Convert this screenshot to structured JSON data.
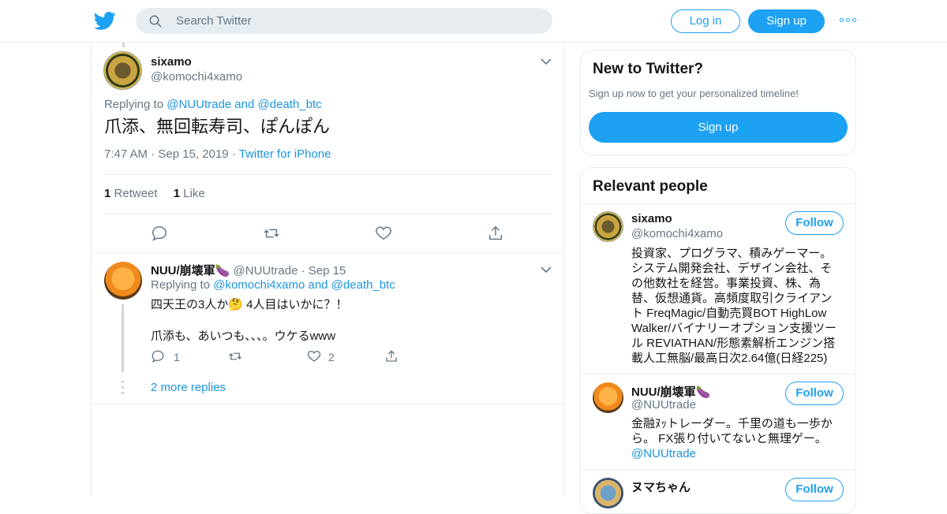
{
  "header": {
    "search_placeholder": "Search Twitter",
    "login_label": "Log in",
    "signup_label": "Sign up"
  },
  "main_tweet": {
    "name": "sixamo",
    "handle": "@komochi4xamo",
    "replying_prefix": "Replying to",
    "replying_to": "@NUUtrade and @death_btc",
    "text": "爪添、無回転寿司、ぽんぽん",
    "time": "7:47 AM",
    "date": "Sep 15, 2019",
    "source": "Twitter for iPhone",
    "retweets_count": "1",
    "retweets_label": "Retweet",
    "likes_count": "1",
    "likes_label": "Like"
  },
  "reply": {
    "name": "NUU/崩壊軍🍆",
    "handle": "@NUUtrade",
    "date": "Sep 15",
    "replying_prefix": "Replying to",
    "replying_to": "@komochi4xamo and @death_btc",
    "line1": "四天王の3人か🤔 4人目はいかに？！",
    "line2": "爪添も、あいつも、、、。ウケるwww",
    "reply_count": "1",
    "like_count": "2",
    "more_replies": "2 more replies"
  },
  "new_card": {
    "title": "New to Twitter?",
    "subtitle": "Sign up now to get your personalized timeline!",
    "button": "Sign up"
  },
  "relevant": {
    "title": "Relevant people",
    "follow_label": "Follow",
    "people": [
      {
        "name": "sixamo",
        "handle": "@komochi4xamo",
        "bio_lines": [
          "投資家、プログラマ、積みゲーマー。",
          "システム開発会社、デザイン会社、そ",
          "の他数社を経営。事業投資、株、為",
          "替、仮想通貨。高頻度取引クライアン",
          "ト FreqMagic/自動売買BOT HighLow",
          "Walker/バイナリーオプション支援ツー",
          "ル REVIATHAN/形態素解析エンジン搭",
          "載人工無脳/最高日次2.64億(日経225)"
        ]
      },
      {
        "name": "NUU/崩壊軍🍆",
        "handle": "@NUUtrade",
        "bio_lines": [
          "金融ﾇｯトレーダー。千里の道も一歩か",
          "ら。 FX張り付いてないと無理ゲー。"
        ],
        "bio_link": "@NUUtrade"
      },
      {
        "name": "ヌマちゃん",
        "handle": ""
      }
    ]
  },
  "colors": {
    "accent": "#1da1f2",
    "link": "#1b95e0",
    "muted": "#657786",
    "border": "#e6ecf0"
  }
}
